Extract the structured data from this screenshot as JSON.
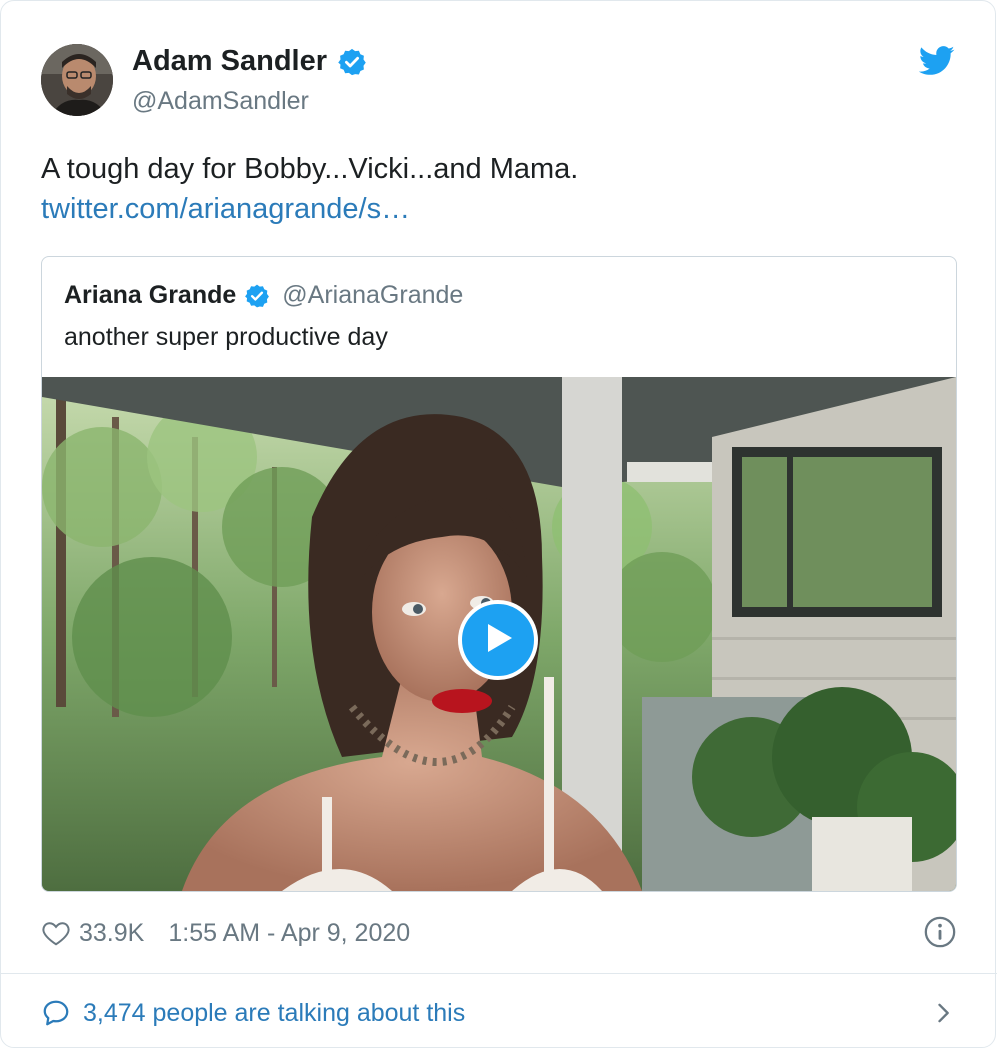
{
  "author": {
    "name": "Adam Sandler",
    "handle": "@AdamSandler",
    "verified": true
  },
  "tweet": {
    "text": "A tough day for Bobby...Vicki...and Mama.",
    "link": "twitter.com/arianagrande/s…"
  },
  "quoted_tweet": {
    "name": "Ariana Grande",
    "handle": "@ArianaGrande",
    "verified": true,
    "text": "another super productive day",
    "media": "video"
  },
  "footer": {
    "likes": "33.9K",
    "timestamp": "1:55 AM - Apr 9, 2020"
  },
  "conversation": {
    "text": "3,474 people are talking about this"
  },
  "colors": {
    "twitter_blue": "#1da1f2",
    "link_blue": "#2b7bb9",
    "text_dark": "#1c2022",
    "text_gray": "#697882",
    "border": "#e1e8ed"
  },
  "icons": [
    "twitter-bird-icon",
    "verified-badge-icon",
    "play-icon",
    "heart-icon",
    "info-icon",
    "speech-bubble-icon",
    "chevron-right-icon"
  ]
}
